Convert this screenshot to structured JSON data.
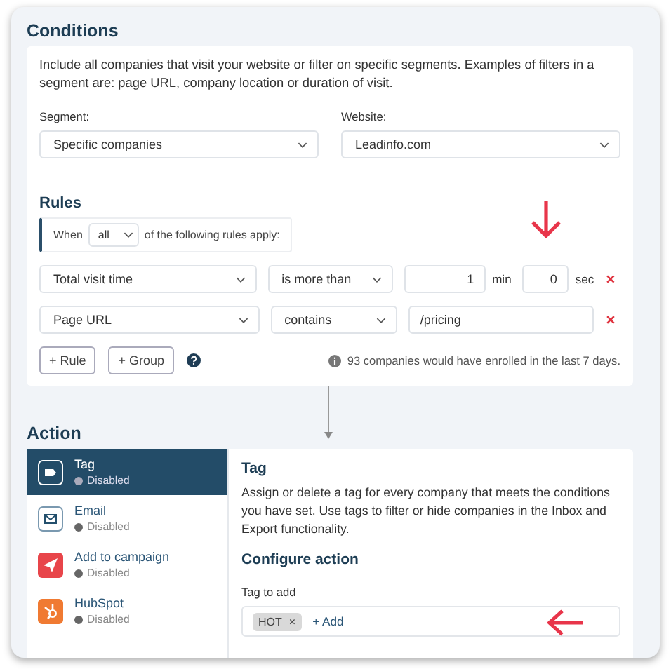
{
  "conditions": {
    "title": "Conditions",
    "description": "Include all companies that visit your website or filter on specific segments. Examples of filters in a segment are: page URL, company location or duration of visit.",
    "segment": {
      "label": "Segment:",
      "value": "Specific companies"
    },
    "website": {
      "label": "Website:",
      "value": "Leadinfo.com"
    },
    "rules": {
      "title": "Rules",
      "when_prefix": "When",
      "match": "all",
      "when_suffix": "of the following rules apply:",
      "rows": [
        {
          "kind": "duration",
          "field": "Total visit time",
          "operator": "is more than",
          "minutes": "1",
          "min_unit": "min",
          "seconds": "0",
          "sec_unit": "sec"
        },
        {
          "kind": "text",
          "field": "Page URL",
          "operator": "contains",
          "value": "/pricing"
        }
      ],
      "add_rule": "+ Rule",
      "add_group": "+ Group",
      "estimate": "93 companies would have enrolled in the last 7 days."
    }
  },
  "action": {
    "title": "Action",
    "items": [
      {
        "kind": "tag",
        "name": "Tag",
        "status": "Disabled",
        "selected": true
      },
      {
        "kind": "email",
        "name": "Email",
        "status": "Disabled",
        "selected": false
      },
      {
        "kind": "campaign",
        "name": "Add to campaign",
        "status": "Disabled",
        "selected": false
      },
      {
        "kind": "hubspot",
        "name": "HubSpot",
        "status": "Disabled",
        "selected": false
      }
    ],
    "detail": {
      "title": "Tag",
      "description": "Assign or delete a tag for every company that meets the conditions you have set. Use tags to filter or hide companies in the Inbox and Export functionality.",
      "configure_title": "Configure action",
      "tag_label": "Tag to add",
      "tags": [
        {
          "label": "HOT",
          "remove": "×"
        }
      ],
      "add": "+ Add"
    }
  }
}
